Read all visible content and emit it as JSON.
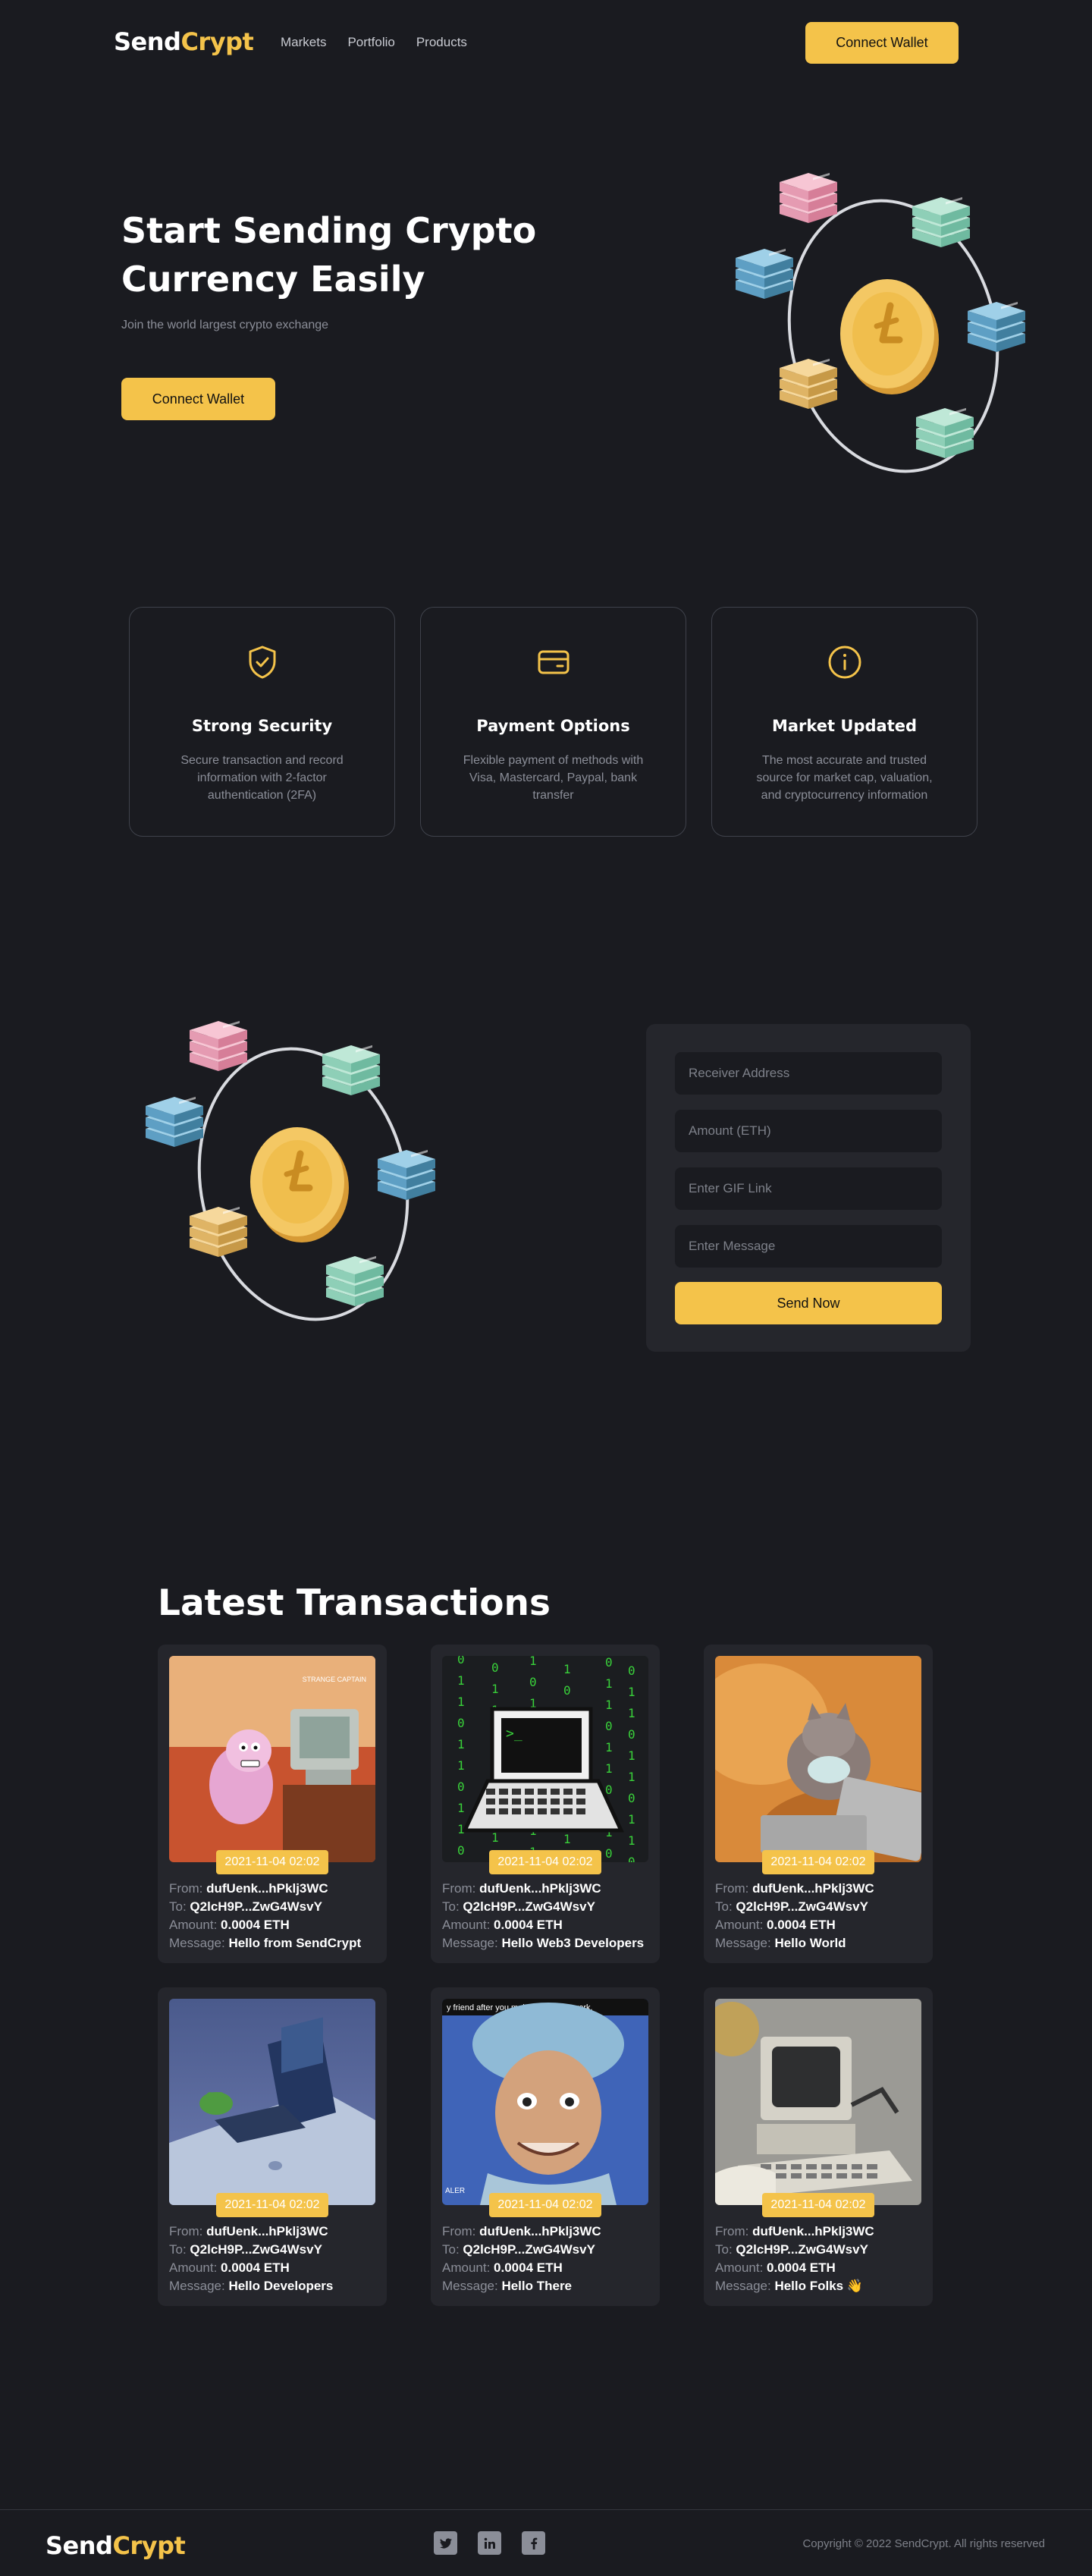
{
  "brand": {
    "part1": "Send",
    "part2": "Crypt"
  },
  "nav": [
    "Markets",
    "Portfolio",
    "Products"
  ],
  "header_button": "Connect Wallet",
  "hero": {
    "title": "Start Sending Crypto Currency Easily",
    "subtitle": "Join the world largest crypto exchange",
    "button": "Connect Wallet"
  },
  "features": [
    {
      "icon": "shield-check-icon",
      "title": "Strong Security",
      "text": "Secure transaction and record information with 2-factor authentication (2FA)"
    },
    {
      "icon": "credit-card-icon",
      "title": "Payment Options",
      "text": "Flexible payment of methods with Visa, Mastercard, Paypal, bank transfer"
    },
    {
      "icon": "info-circle-icon",
      "title": "Market Updated",
      "text": "The most accurate and trusted source for market cap, valuation, and cryptocurrency information"
    }
  ],
  "send_form": {
    "receiver_placeholder": "Receiver Address",
    "amount_placeholder": "Amount (ETH)",
    "gif_placeholder": "Enter GIF Link",
    "message_placeholder": "Enter Message",
    "button": "Send Now"
  },
  "transactions_title": "Latest Transactions",
  "tx_labels": {
    "from": "From:",
    "to": "To:",
    "amount": "Amount:",
    "message": "Message:"
  },
  "transactions": [
    {
      "date": "2021-11-04 02:02",
      "from": "dufUenk...hPklj3WC",
      "to": "Q2lcH9P...ZwG4WsvY",
      "amount": "0.0004 ETH",
      "message": "Hello from SendCrypt",
      "image": "courage-dog-computer",
      "watermark": "STRANGE CAPTAIN"
    },
    {
      "date": "2021-11-04 02:02",
      "from": "dufUenk...hPklj3WC",
      "to": "Q2lcH9P...ZwG4WsvY",
      "amount": "0.0004 ETH",
      "message": "Hello Web3 Developers",
      "image": "pixel-laptop-matrix",
      "watermark": ""
    },
    {
      "date": "2021-11-04 02:02",
      "from": "dufUenk...hPklj3WC",
      "to": "Q2lcH9P...ZwG4WsvY",
      "amount": "0.0004 ETH",
      "message": "Hello World",
      "image": "cat-typing-laptop",
      "watermark": ""
    },
    {
      "date": "2021-11-04 02:02",
      "from": "dufUenk...hPklj3WC",
      "to": "Q2lcH9P...ZwG4WsvY",
      "amount": "0.0004 ETH",
      "message": "Hello Developers",
      "image": "frog-computer-desk",
      "watermark": ""
    },
    {
      "date": "2021-11-04 02:02",
      "from": "dufUenk...hPklj3WC",
      "to": "Q2lcH9P...ZwG4WsvY",
      "amount": "0.0004 ETH",
      "message": "Hello There",
      "image": "surgeon-meme",
      "watermark": "y friend after you make their code work.",
      "watermark2": "ALER"
    },
    {
      "date": "2021-11-04 02:02",
      "from": "dufUenk...hPklj3WC",
      "to": "Q2lcH9P...ZwG4WsvY",
      "amount": "0.0004 ETH",
      "message": "Hello Folks 👋",
      "image": "old-computer-robot-arm",
      "watermark": ""
    }
  ],
  "footer": {
    "socials": [
      "twitter-icon",
      "linkedin-icon",
      "facebook-icon"
    ],
    "copyright": "Copyright © 2022 SendCrypt. All rights reserved"
  },
  "colors": {
    "accent": "#f4c34a",
    "background": "#1a1b20",
    "card": "#25262c"
  }
}
